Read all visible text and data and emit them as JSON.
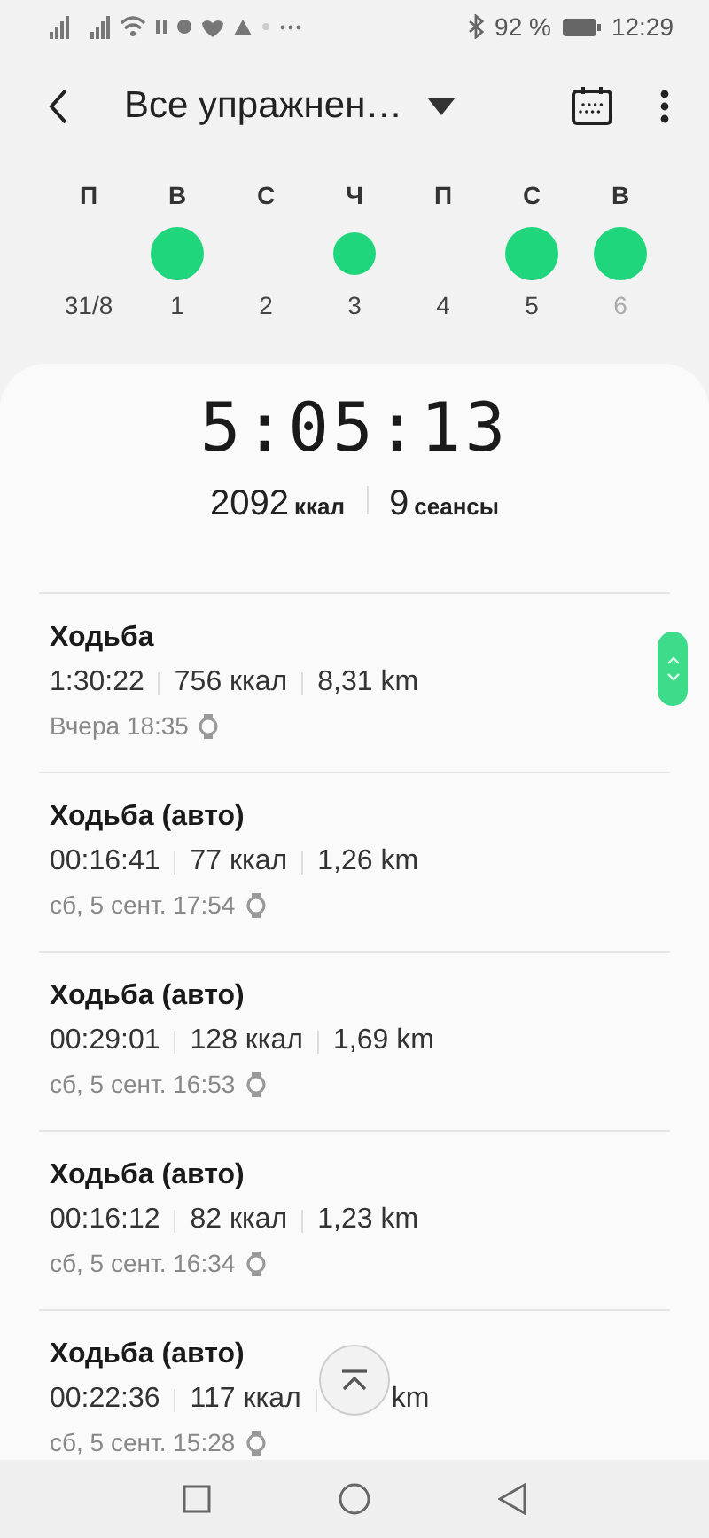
{
  "status_bar": {
    "battery": "92 %",
    "time": "12:29"
  },
  "header": {
    "title": "Все упражнен…"
  },
  "week": [
    {
      "day": "П",
      "date": "31/8",
      "kind": "empty",
      "dimmed": false
    },
    {
      "day": "В",
      "date": "1",
      "kind": "large",
      "dimmed": false
    },
    {
      "day": "С",
      "date": "2",
      "kind": "empty",
      "dimmed": false
    },
    {
      "day": "Ч",
      "date": "3",
      "kind": "small",
      "dimmed": false
    },
    {
      "day": "П",
      "date": "4",
      "kind": "empty",
      "dimmed": false
    },
    {
      "day": "С",
      "date": "5",
      "kind": "large",
      "dimmed": false
    },
    {
      "day": "В",
      "date": "6",
      "kind": "large",
      "dimmed": true
    }
  ],
  "summary": {
    "total_time": "5:05:13",
    "calories": "2092",
    "calories_unit": "ккал",
    "sessions": "9",
    "sessions_unit": "сеансы"
  },
  "sessions": [
    {
      "title": "Ходьба",
      "duration": "1:30:22",
      "calories": "756 ккал",
      "distance": "8,31 km",
      "when": "Вчера 18:35"
    },
    {
      "title": "Ходьба (авто)",
      "duration": "00:16:41",
      "calories": "77 ккал",
      "distance": "1,26 km",
      "when": "сб, 5 сент. 17:54"
    },
    {
      "title": "Ходьба (авто)",
      "duration": "00:29:01",
      "calories": "128 ккал",
      "distance": "1,69 km",
      "when": "сб, 5 сент. 16:53"
    },
    {
      "title": "Ходьба (авто)",
      "duration": "00:16:12",
      "calories": "82 ккал",
      "distance": "1,23 km",
      "when": "сб, 5 сент. 16:34"
    },
    {
      "title": "Ходьба (авто)",
      "duration": "00:22:36",
      "calories": "117 ккал",
      "distance": "km",
      "when": "сб, 5 сент. 15:28"
    }
  ]
}
